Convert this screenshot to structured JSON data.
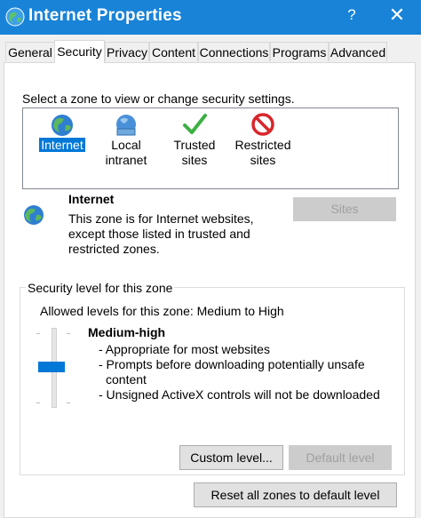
{
  "window": {
    "title": "Internet Properties",
    "help_glyph": "?",
    "close_glyph": "✕",
    "titlebar_color": "#1883d7"
  },
  "tabs": [
    {
      "label": "General"
    },
    {
      "label": "Security"
    },
    {
      "label": "Privacy"
    },
    {
      "label": "Content"
    },
    {
      "label": "Connections"
    },
    {
      "label": "Programs"
    },
    {
      "label": "Advanced"
    }
  ],
  "active_tab": "Security",
  "security": {
    "zone_prompt": "Select a zone to view or change security settings.",
    "zones": [
      {
        "label_line1": "Internet",
        "label_line2": "",
        "icon": "globe-icon",
        "selected": true
      },
      {
        "label_line1": "Local",
        "label_line2": "intranet",
        "icon": "intranet-globe-icon",
        "selected": false
      },
      {
        "label_line1": "Trusted",
        "label_line2": "sites",
        "icon": "check-icon",
        "selected": false
      },
      {
        "label_line1": "Restricted",
        "label_line2": "sites",
        "icon": "no-entry-icon",
        "selected": false
      }
    ],
    "zone_name": "Internet",
    "zone_description": "This zone is for Internet websites, except those listed in trusted and restricted zones.",
    "sites_button": "Sites",
    "level_group_label": "Security level for this zone",
    "allowed_levels": "Allowed levels for this zone: Medium to High",
    "level_name": "Medium-high",
    "level_details": [
      "- Appropriate for most websites",
      "- Prompts before downloading potentially unsafe content",
      "- Unsigned ActiveX controls will not be downloaded"
    ],
    "slider_level_fraction": 0.5,
    "custom_level_button": "Custom level...",
    "default_level_button": "Default level",
    "reset_button": "Reset all zones to default level"
  },
  "colors": {
    "accent": "#0078d7",
    "selection": "#0078d7",
    "disabled_button": "#cccccc"
  }
}
